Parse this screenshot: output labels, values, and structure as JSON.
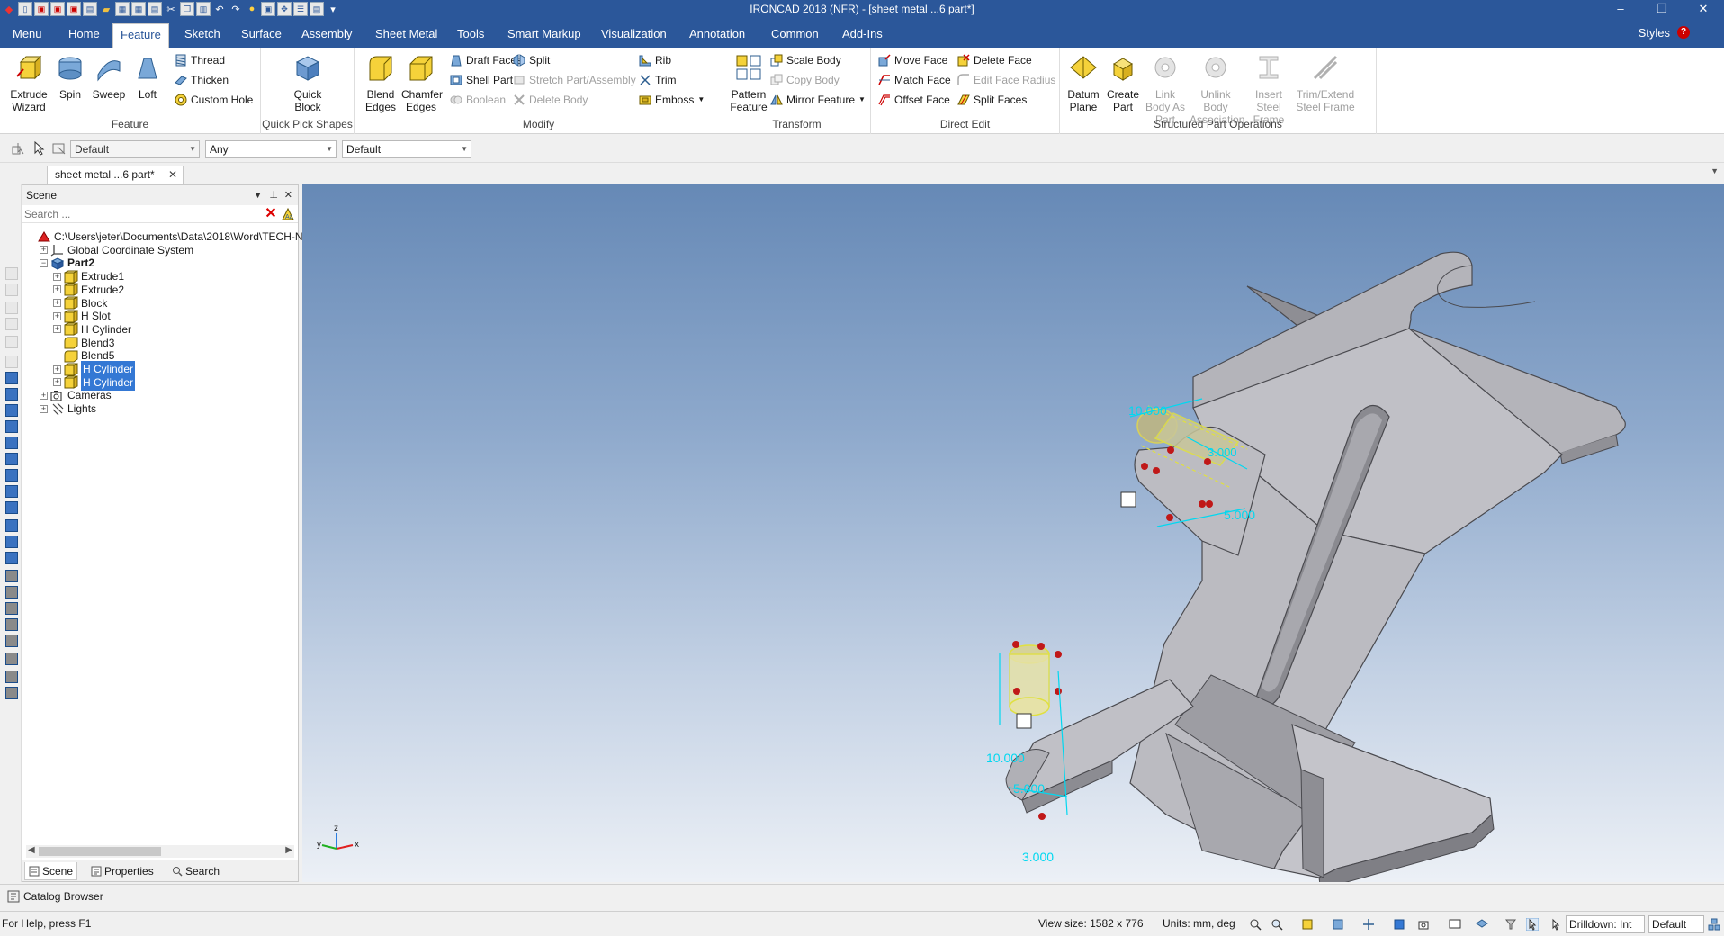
{
  "window": {
    "title": "IRONCAD 2018 (NFR) - [sheet metal ...6 part*]",
    "minimize": "–",
    "restore": "❐",
    "close": "✕"
  },
  "ribbon_tabs": [
    "Menu",
    "Home",
    "Feature",
    "Sketch",
    "Surface",
    "Assembly",
    "Sheet Metal",
    "Tools",
    "Smart Markup",
    "Visualization",
    "Annotation",
    "Common",
    "Add-Ins"
  ],
  "active_tab": "Feature",
  "styles_label": "Styles",
  "help_label": "?",
  "groups": {
    "feature": {
      "label": "Feature",
      "extrude": "Extrude Wizard",
      "spin": "Spin",
      "sweep": "Sweep",
      "loft": "Loft",
      "thread": "Thread",
      "thicken": "Thicken",
      "custom_hole": "Custom Hole"
    },
    "quick_pick": {
      "label": "Quick Pick Shapes",
      "quick_block": "Quick Block"
    },
    "modify": {
      "label": "Modify",
      "blend_edges": "Blend Edges",
      "chamfer_edges": "Chamfer Edges",
      "draft_faces": "Draft Faces",
      "shell_part": "Shell Part",
      "boolean": "Boolean",
      "split": "Split",
      "stretch": "Stretch Part/Assembly",
      "delete_body": "Delete Body",
      "rib": "Rib",
      "trim": "Trim",
      "emboss": "Emboss"
    },
    "transform": {
      "label": "Transform",
      "pattern_feature": "Pattern Feature",
      "scale_body": "Scale Body",
      "copy_body": "Copy Body",
      "mirror_feature": "Mirror Feature"
    },
    "direct_edit": {
      "label": "Direct Edit",
      "move_face": "Move Face",
      "match_face": "Match Face",
      "offset_face": "Offset Face",
      "delete_face": "Delete Face",
      "edit_face_radius": "Edit Face Radius",
      "split_faces": "Split Faces"
    },
    "structured": {
      "label": "Structured Part Operations",
      "datum_plane": "Datum Plane",
      "create_part": "Create Part",
      "link_body": "Link Body As Part",
      "unlink_body": "Unlink Body Association",
      "insert_steel": "Insert Steel Frame",
      "trim_extend": "Trim/Extend Steel Frame"
    }
  },
  "toolbar2": {
    "combo1": "Default",
    "combo2": "Any",
    "combo3": "Default"
  },
  "document_tab": "sheet metal ...6 part*",
  "scene_panel": {
    "title": "Scene",
    "search_placeholder": "Search ...",
    "tree": [
      {
        "label": "C:\\Users\\jeter\\Documents\\Data\\2018\\Word\\TECH-N",
        "level": 0,
        "expander": "",
        "icon": "scene-icon",
        "selected": false,
        "bold": false
      },
      {
        "label": "Global Coordinate System",
        "level": 1,
        "expander": "+",
        "icon": "coordinate-icon",
        "selected": false,
        "bold": false
      },
      {
        "label": "Part2",
        "level": 1,
        "expander": "−",
        "icon": "part-icon",
        "selected": false,
        "bold": true
      },
      {
        "label": "Extrude1",
        "level": 2,
        "expander": "+",
        "icon": "feature-icon",
        "selected": false,
        "bold": false
      },
      {
        "label": "Extrude2",
        "level": 2,
        "expander": "+",
        "icon": "feature-icon",
        "selected": false,
        "bold": false
      },
      {
        "label": "Block",
        "level": 2,
        "expander": "+",
        "icon": "feature-icon",
        "selected": false,
        "bold": false
      },
      {
        "label": "H Slot",
        "level": 2,
        "expander": "+",
        "icon": "feature-icon",
        "selected": false,
        "bold": false
      },
      {
        "label": "H Cylinder",
        "level": 2,
        "expander": "+",
        "icon": "feature-icon",
        "selected": false,
        "bold": false
      },
      {
        "label": "Blend3",
        "level": 2,
        "expander": "",
        "icon": "blend-icon",
        "selected": false,
        "bold": false
      },
      {
        "label": "Blend5",
        "level": 2,
        "expander": "",
        "icon": "blend-icon",
        "selected": false,
        "bold": false
      },
      {
        "label": "H Cylinder",
        "level": 2,
        "expander": "+",
        "icon": "feature-icon",
        "selected": true,
        "bold": false
      },
      {
        "label": "H Cylinder",
        "level": 2,
        "expander": "+",
        "icon": "feature-icon",
        "selected": true,
        "bold": false
      },
      {
        "label": "Cameras",
        "level": 1,
        "expander": "+",
        "icon": "camera-icon",
        "selected": false,
        "bold": false
      },
      {
        "label": "Lights",
        "level": 1,
        "expander": "+",
        "icon": "light-icon",
        "selected": false,
        "bold": false
      }
    ],
    "tabs": {
      "scene": "Scene",
      "properties": "Properties",
      "search": "Search"
    }
  },
  "viewport": {
    "dim_top_width": "10.000",
    "dim_top_small": "3.000",
    "dim_top_height": "5.000",
    "dim_bottom_width": "10.000",
    "dim_bottom_small": "5.000",
    "dim_bottom_height": "3.000",
    "triad_x": "x",
    "triad_y": "y",
    "triad_z": "z"
  },
  "catalog_browser": "Catalog Browser",
  "statusbar": {
    "help": "For Help, press F1",
    "view_size": "View size: 1582 x 776",
    "units": "Units: mm, deg",
    "drilldown": "Drilldown: Int",
    "mode": "Default"
  },
  "colors": {
    "ribbon_blue": "#2b579a",
    "selection": "#3478d4",
    "dimension": "#00d8f0",
    "part_gray": "#b4b4b9"
  }
}
